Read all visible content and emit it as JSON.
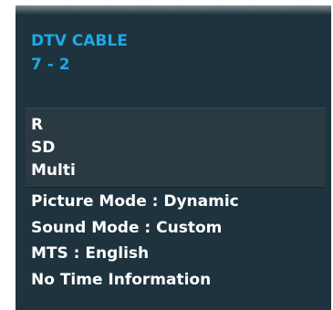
{
  "channel": {
    "source": "DTV CABLE",
    "number": "7 - 2"
  },
  "signal_info": {
    "rating": "R",
    "definition": "SD",
    "audio": "Multi"
  },
  "status": {
    "picture_mode": "Picture Mode : Dynamic",
    "sound_mode": "Sound Mode : Custom",
    "mts": "MTS : English",
    "time_info": "No Time Information"
  },
  "colors": {
    "background": "#1e333d",
    "accent": "#1fa8e8",
    "text": "#ffffff",
    "info_box": "#2b3943"
  }
}
